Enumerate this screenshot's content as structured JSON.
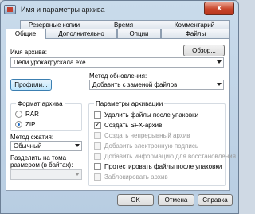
{
  "window": {
    "title": "Имя и параметры архива",
    "close_label": "x"
  },
  "tabs_back": [
    "Резервные копии",
    "Время",
    "Комментарий"
  ],
  "tabs_front": [
    "Общие",
    "Дополнительно",
    "Опции",
    "Файлы"
  ],
  "general": {
    "archive_name_label": "Имя архива:",
    "browse_button": "Обзор...",
    "archive_name_value": "Цели урокакрускала.exe",
    "update_method_label": "Метод обновления:",
    "profiles_button": "Профили...",
    "update_method_value": "Добавить с заменой файлов",
    "archive_format_title": "Формат архива",
    "format_options": [
      {
        "label": "RAR",
        "selected": false
      },
      {
        "label": "ZIP",
        "selected": true
      }
    ],
    "compression_label": "Метод сжатия:",
    "compression_value": "Обычный",
    "split_label_line1": "Разделить на тома",
    "split_label_line2": "размером (в байтах):",
    "archive_options_title": "Параметры архивации",
    "options": [
      {
        "label": "Удалить файлы после упаковки",
        "checked": false,
        "enabled": true
      },
      {
        "label": "Создать SFX-архив",
        "checked": true,
        "enabled": true
      },
      {
        "label": "Создать непрерывный архив",
        "checked": false,
        "enabled": false
      },
      {
        "label": "Добавить электронную подпись",
        "checked": false,
        "enabled": false
      },
      {
        "label": "Добавить информацию для восстановления",
        "checked": false,
        "enabled": false
      },
      {
        "label": "Протестировать файлы после упаковки",
        "checked": false,
        "enabled": true
      },
      {
        "label": "Заблокировать архив",
        "checked": false,
        "enabled": false
      }
    ]
  },
  "footer": {
    "ok": "OK",
    "cancel": "Отмена",
    "help": "Справка"
  }
}
